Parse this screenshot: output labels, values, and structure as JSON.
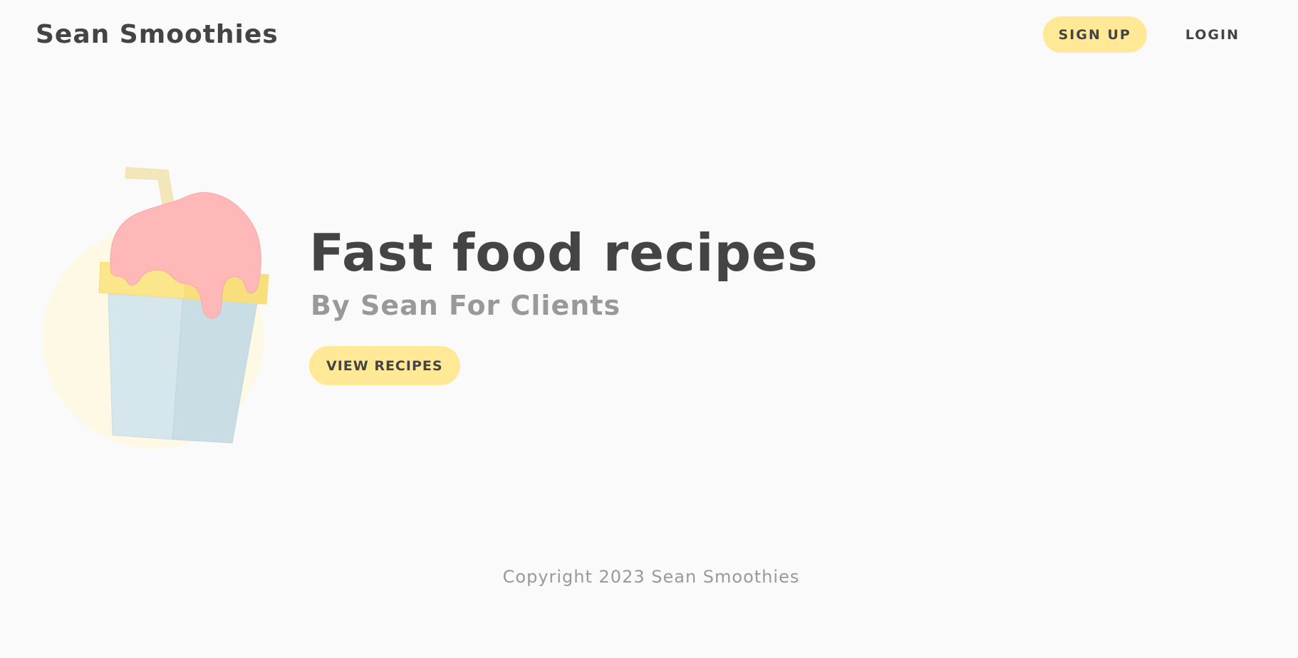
{
  "header": {
    "brand": "Sean Smoothies",
    "nav": {
      "signup_label": "SIGN UP",
      "login_label": "LOGIN"
    }
  },
  "hero": {
    "title": "Fast food recipes",
    "subtitle": "By Sean For Clients",
    "cta_label": "VIEW RECIPES"
  },
  "footer": {
    "copyright": "Copyright 2023 Sean Smoothies"
  },
  "illustration": {
    "icon": "smoothie-cup-icon"
  },
  "colors": {
    "background": "#fafafa",
    "text": "#444444",
    "muted": "#999999",
    "accent": "#ffe896",
    "topping": "#ffb8b8",
    "cup": "#d3e6ec"
  }
}
